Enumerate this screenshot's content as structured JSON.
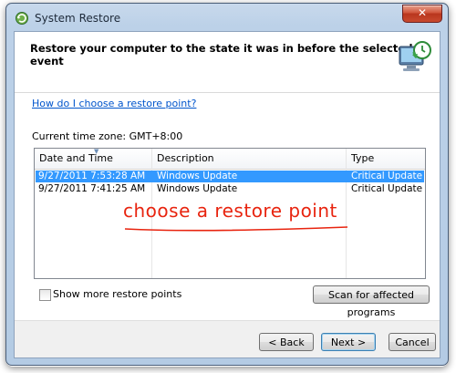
{
  "window": {
    "title": "System Restore",
    "close_label": "✕"
  },
  "header": {
    "headline": "Restore your computer to the state it was in before the selected event"
  },
  "help_link": "How do I choose a restore point?",
  "timezone": "Current time zone: GMT+8:00",
  "table": {
    "columns": [
      "Date and Time",
      "Description",
      "Type"
    ],
    "rows": [
      {
        "date": "9/27/2011 7:53:28 AM",
        "description": "Windows Update",
        "type": "Critical Update",
        "selected": true
      },
      {
        "date": "9/27/2011 7:41:25 AM",
        "description": "Windows Update",
        "type": "Critical Update",
        "selected": false
      }
    ]
  },
  "annotation": "choose a restore point",
  "show_more_label": "Show more restore points",
  "buttons": {
    "scan": "Scan for affected programs",
    "back": "< Back",
    "next": "Next >",
    "cancel": "Cancel"
  },
  "colors": {
    "selection": "#3399ff",
    "annotation": "#e8240f",
    "link": "#0055cc"
  }
}
